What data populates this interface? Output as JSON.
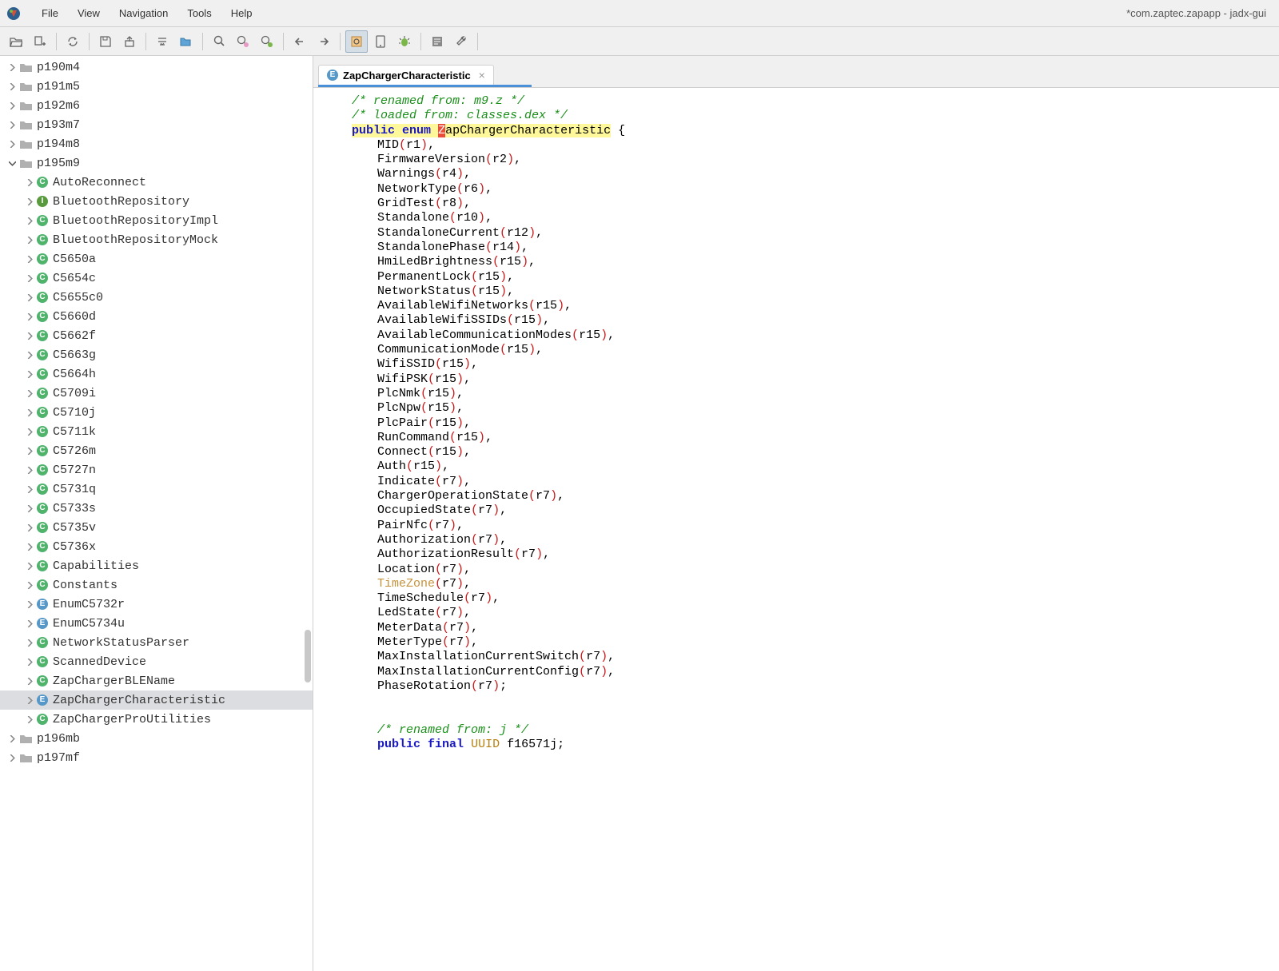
{
  "window": {
    "title": "*com.zaptec.zapapp - jadx-gui"
  },
  "menubar": {
    "items": [
      "File",
      "View",
      "Navigation",
      "Tools",
      "Help"
    ]
  },
  "toolbar": {
    "icons": [
      "open",
      "add-lib",
      "sync",
      "save-all",
      "export",
      "settings-code",
      "save-mapping",
      "search",
      "search-class-pink",
      "search-class-green",
      "back",
      "forward",
      "code-settings",
      "device",
      "bug",
      "log",
      "wrench"
    ]
  },
  "sidebar": {
    "packages": [
      {
        "name": "p190m4",
        "indent": 1,
        "type": "folder"
      },
      {
        "name": "p191m5",
        "indent": 1,
        "type": "folder"
      },
      {
        "name": "p192m6",
        "indent": 1,
        "type": "folder"
      },
      {
        "name": "p193m7",
        "indent": 1,
        "type": "folder"
      },
      {
        "name": "p194m8",
        "indent": 1,
        "type": "folder"
      },
      {
        "name": "p195m9",
        "indent": 1,
        "type": "folder",
        "expanded": true
      },
      {
        "name": "AutoReconnect",
        "indent": 2,
        "type": "class-c"
      },
      {
        "name": "BluetoothRepository",
        "indent": 2,
        "type": "class-i"
      },
      {
        "name": "BluetoothRepositoryImpl",
        "indent": 2,
        "type": "class-c"
      },
      {
        "name": "BluetoothRepositoryMock",
        "indent": 2,
        "type": "class-c"
      },
      {
        "name": "C5650a",
        "indent": 2,
        "type": "class-c"
      },
      {
        "name": "C5654c",
        "indent": 2,
        "type": "class-c"
      },
      {
        "name": "C5655c0",
        "indent": 2,
        "type": "class-c"
      },
      {
        "name": "C5660d",
        "indent": 2,
        "type": "class-c"
      },
      {
        "name": "C5662f",
        "indent": 2,
        "type": "class-c"
      },
      {
        "name": "C5663g",
        "indent": 2,
        "type": "class-c"
      },
      {
        "name": "C5664h",
        "indent": 2,
        "type": "class-c"
      },
      {
        "name": "C5709i",
        "indent": 2,
        "type": "class-c"
      },
      {
        "name": "C5710j",
        "indent": 2,
        "type": "class-c"
      },
      {
        "name": "C5711k",
        "indent": 2,
        "type": "class-c"
      },
      {
        "name": "C5726m",
        "indent": 2,
        "type": "class-c"
      },
      {
        "name": "C5727n",
        "indent": 2,
        "type": "class-c"
      },
      {
        "name": "C5731q",
        "indent": 2,
        "type": "class-c"
      },
      {
        "name": "C5733s",
        "indent": 2,
        "type": "class-c"
      },
      {
        "name": "C5735v",
        "indent": 2,
        "type": "class-c"
      },
      {
        "name": "C5736x",
        "indent": 2,
        "type": "class-c"
      },
      {
        "name": "Capabilities",
        "indent": 2,
        "type": "class-c"
      },
      {
        "name": "Constants",
        "indent": 2,
        "type": "class-c"
      },
      {
        "name": "EnumC5732r",
        "indent": 2,
        "type": "class-e"
      },
      {
        "name": "EnumC5734u",
        "indent": 2,
        "type": "class-e"
      },
      {
        "name": "NetworkStatusParser",
        "indent": 2,
        "type": "class-c"
      },
      {
        "name": "ScannedDevice",
        "indent": 2,
        "type": "class-c"
      },
      {
        "name": "ZapChargerBLEName",
        "indent": 2,
        "type": "class-c"
      },
      {
        "name": "ZapChargerCharacteristic",
        "indent": 2,
        "type": "class-e",
        "selected": true
      },
      {
        "name": "ZapChargerProUtilities",
        "indent": 2,
        "type": "class-c"
      },
      {
        "name": "p196mb",
        "indent": 1,
        "type": "folder"
      },
      {
        "name": "p197mf",
        "indent": 1,
        "type": "folder"
      }
    ]
  },
  "tab": {
    "label": "ZapChargerCharacteristic",
    "icon": "E"
  },
  "code": {
    "comment1": "/* renamed from: m9.z */",
    "comment2": "/* loaded from: classes.dex */",
    "decl_public": "public",
    "decl_enum": "enum",
    "decl_classZ": "Z",
    "decl_classRest": "apChargerCharacteristic",
    "brace_open": " {",
    "entries": [
      {
        "name": "MID",
        "arg": "r1",
        "sep": ","
      },
      {
        "name": "FirmwareVersion",
        "arg": "r2",
        "sep": ","
      },
      {
        "name": "Warnings",
        "arg": "r4",
        "sep": ","
      },
      {
        "name": "NetworkType",
        "arg": "r6",
        "sep": ","
      },
      {
        "name": "GridTest",
        "arg": "r8",
        "sep": ","
      },
      {
        "name": "Standalone",
        "arg": "r10",
        "sep": ","
      },
      {
        "name": "StandaloneCurrent",
        "arg": "r12",
        "sep": ","
      },
      {
        "name": "StandalonePhase",
        "arg": "r14",
        "sep": ","
      },
      {
        "name": "HmiLedBrightness",
        "arg": "r15",
        "sep": ","
      },
      {
        "name": "PermanentLock",
        "arg": "r15",
        "sep": ","
      },
      {
        "name": "NetworkStatus",
        "arg": "r15",
        "sep": ","
      },
      {
        "name": "AvailableWifiNetworks",
        "arg": "r15",
        "sep": ","
      },
      {
        "name": "AvailableWifiSSIDs",
        "arg": "r15",
        "sep": ","
      },
      {
        "name": "AvailableCommunicationModes",
        "arg": "r15",
        "sep": ","
      },
      {
        "name": "CommunicationMode",
        "arg": "r15",
        "sep": ","
      },
      {
        "name": "WifiSSID",
        "arg": "r15",
        "sep": ","
      },
      {
        "name": "WifiPSK",
        "arg": "r15",
        "sep": ","
      },
      {
        "name": "PlcNmk",
        "arg": "r15",
        "sep": ","
      },
      {
        "name": "PlcNpw",
        "arg": "r15",
        "sep": ","
      },
      {
        "name": "PlcPair",
        "arg": "r15",
        "sep": ","
      },
      {
        "name": "RunCommand",
        "arg": "r15",
        "sep": ","
      },
      {
        "name": "Connect",
        "arg": "r15",
        "sep": ","
      },
      {
        "name": "Auth",
        "arg": "r15",
        "sep": ","
      },
      {
        "name": "Indicate",
        "arg": "r7",
        "sep": ","
      },
      {
        "name": "ChargerOperationState",
        "arg": "r7",
        "sep": ","
      },
      {
        "name": "OccupiedState",
        "arg": "r7",
        "sep": ","
      },
      {
        "name": "PairNfc",
        "arg": "r7",
        "sep": ","
      },
      {
        "name": "Authorization",
        "arg": "r7",
        "sep": ","
      },
      {
        "name": "AuthorizationResult",
        "arg": "r7",
        "sep": ","
      },
      {
        "name": "Location",
        "arg": "r7",
        "sep": ","
      },
      {
        "name": "TimeZone",
        "arg": "r7",
        "sep": ",",
        "warn": true
      },
      {
        "name": "TimeSchedule",
        "arg": "r7",
        "sep": ","
      },
      {
        "name": "LedState",
        "arg": "r7",
        "sep": ","
      },
      {
        "name": "MeterData",
        "arg": "r7",
        "sep": ","
      },
      {
        "name": "MeterType",
        "arg": "r7",
        "sep": ","
      },
      {
        "name": "MaxInstallationCurrentSwitch",
        "arg": "r7",
        "sep": ","
      },
      {
        "name": "MaxInstallationCurrentConfig",
        "arg": "r7",
        "sep": ","
      },
      {
        "name": "PhaseRotation",
        "arg": "r7",
        "sep": ";"
      }
    ],
    "comment3": "/* renamed from: j */",
    "field_public": "public",
    "field_final": "final",
    "field_type": "UUID",
    "field_name": " f16571j;"
  }
}
